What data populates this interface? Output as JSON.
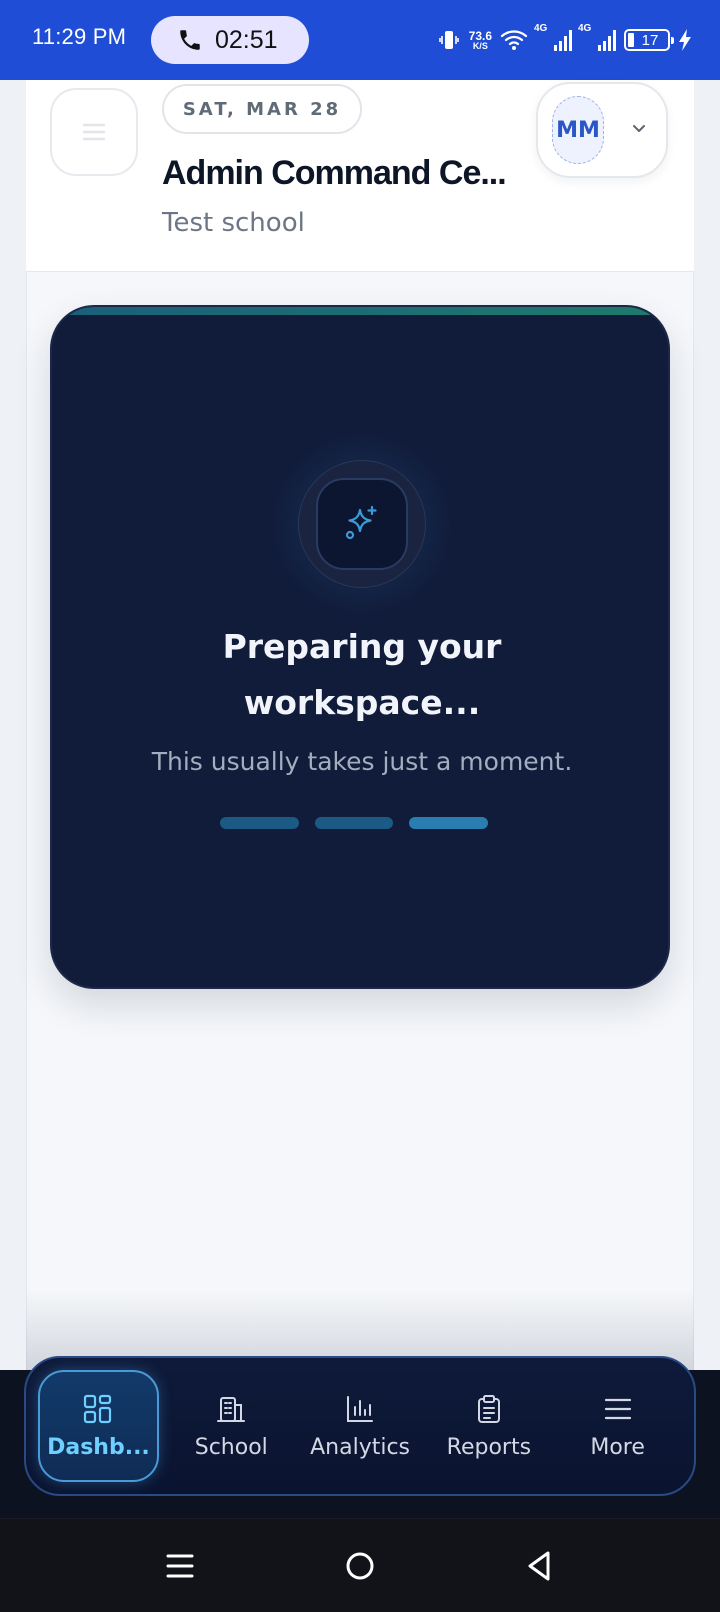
{
  "status_bar": {
    "time": "11:29 PM",
    "call_timer": "02:51",
    "net_speed_value": "73.6",
    "net_speed_unit": "K/S",
    "signal_1_label": "4G",
    "signal_2_label": "4G",
    "battery_level": "17",
    "icons": [
      "vibrate-icon",
      "wifi-icon",
      "signal-icon",
      "battery-icon",
      "charging-icon"
    ]
  },
  "header": {
    "date": "SAT, MAR 28",
    "title": "Admin Command Ce...",
    "subtitle": "Test school",
    "avatar_initials": "MM"
  },
  "loading": {
    "title_line1": "Preparing your",
    "title_line2": "workspace...",
    "subtitle": "This usually takes just a moment."
  },
  "bottom_nav": {
    "items": [
      {
        "label": "Dashb...",
        "icon": "dashboard-grid-icon",
        "active": true
      },
      {
        "label": "School",
        "icon": "school-building-icon",
        "active": false
      },
      {
        "label": "Analytics",
        "icon": "bar-chart-icon",
        "active": false
      },
      {
        "label": "Reports",
        "icon": "clipboard-icon",
        "active": false
      },
      {
        "label": "More",
        "icon": "menu-lines-icon",
        "active": false
      }
    ]
  },
  "system_nav": [
    "recents-icon",
    "home-icon",
    "back-icon"
  ],
  "colors": {
    "status_bar": "#1f4dd6",
    "card_bg": "#111c3a",
    "accent_active": "#6fd0ff",
    "nav_bg": "#0d1220"
  }
}
